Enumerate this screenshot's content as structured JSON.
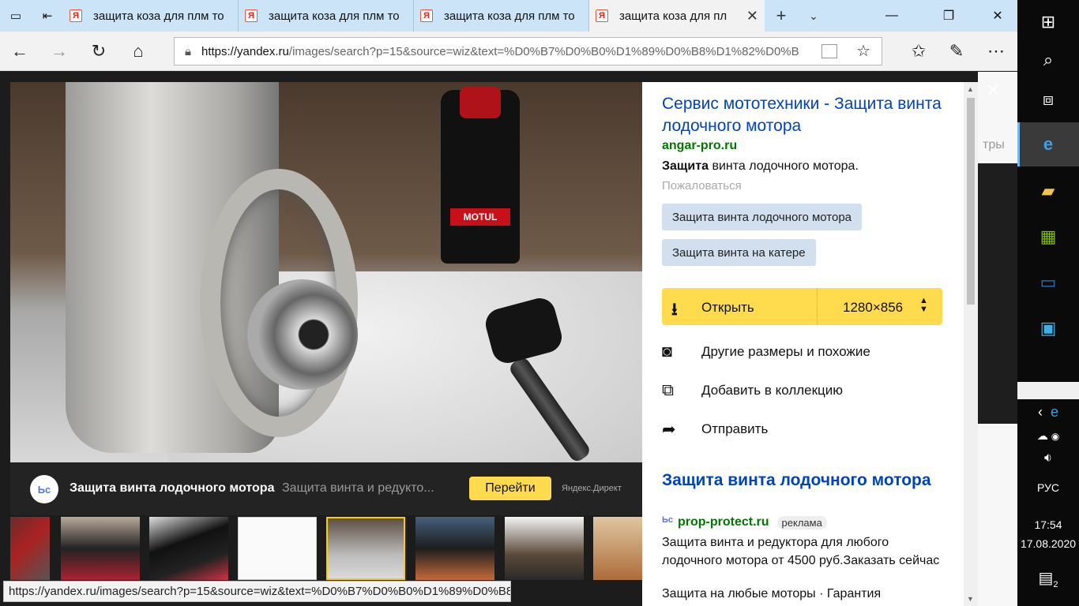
{
  "browser": {
    "tabs": [
      {
        "title": "защита коза для плм то",
        "favicon": "Я"
      },
      {
        "title": "защита коза для плм то",
        "favicon": "Я"
      },
      {
        "title": "защита коза для плм то",
        "favicon": "Я"
      },
      {
        "title": "защита коза для пл",
        "favicon": "Я"
      }
    ],
    "url_host": "https://yandex.ru",
    "url_path": "/images/search?p=15&source=wiz&text=%D0%B7%D0%B0%D1%89%D0%B8%D1%82%D0%B"
  },
  "page": {
    "bg_fragment": "тры",
    "close_icon": "×"
  },
  "photo": {
    "bottle_label": "MOTUL"
  },
  "ad_bar": {
    "logo": "Ьс",
    "title": "Защита винта лодочного мотора",
    "text": "Защита винта и редукто...",
    "button": "Перейти",
    "source": "Яндекс.Директ"
  },
  "status_url": "https://yandex.ru/images/search?p=15&source=wiz&text=%D0%B7%D0%B0%D1%89%D0%B8%",
  "panel": {
    "title": "Сервис мототехники - Защита винта лодочного мотора",
    "domain": "angar-pro.ru",
    "desc_bold": "Защита",
    "desc_rest": " винта лодочного мотора.",
    "report": "Пожаловаться",
    "tags": [
      "Защита винта лодочного мотора",
      "Защита винта на катере"
    ],
    "open_label": "Открыть",
    "open_size": "1280×856",
    "actions": [
      {
        "icon": "camera-icon",
        "label": "Другие размеры и похожие"
      },
      {
        "icon": "collection-icon",
        "label": "Добавить в коллекцию"
      },
      {
        "icon": "share-icon",
        "label": "Отправить"
      }
    ],
    "ad": {
      "title": "Защита винта лодочного мотора",
      "domain": "prop-protect.ru",
      "badge": "реклама",
      "text": "Защита винта и редуктора для любого лодочного мотора от 4500 руб.Заказать сейчас",
      "more": "Защита на любые моторы · Гарантия"
    }
  },
  "taskbar": {
    "lang": "РУС",
    "time": "17:54",
    "date": "17.08.2020",
    "notifications": "2"
  },
  "colors": {
    "accent_yellow": "#ffdb4d",
    "link_blue": "#0044bb",
    "domain_green": "#007700",
    "tab_strip": "#cce4f7"
  }
}
